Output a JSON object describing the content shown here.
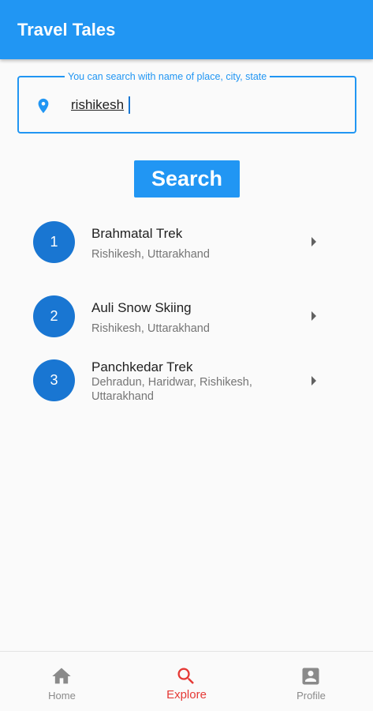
{
  "app_bar": {
    "title": "Travel Tales"
  },
  "search": {
    "legend": "You can search with name of place, city, state",
    "value": "rishikesh",
    "button_label": "Search"
  },
  "results": [
    {
      "number": "1",
      "title": "Brahmatal Trek",
      "subtitle": "Rishikesh, Uttarakhand"
    },
    {
      "number": "2",
      "title": "Auli Snow Skiing",
      "subtitle": "Rishikesh, Uttarakhand"
    },
    {
      "number": "3",
      "title": "Panchkedar Trek",
      "subtitle": "Dehradun, Haridwar, Rishikesh, Uttarakhand"
    }
  ],
  "bottom_nav": {
    "items": [
      {
        "label": "Home",
        "icon": "home-icon"
      },
      {
        "label": "Explore",
        "icon": "search-icon",
        "active": true
      },
      {
        "label": "Profile",
        "icon": "account-box-icon"
      }
    ]
  },
  "colors": {
    "primary": "#2196f3",
    "circle": "#1976d2",
    "active_nav": "#e53935",
    "inactive_nav": "#8a8a8a"
  }
}
